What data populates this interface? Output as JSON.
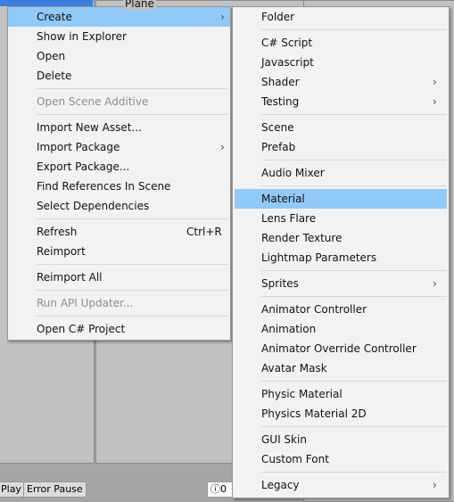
{
  "background": {
    "top_label": "Plane",
    "status_buttons": [
      "Play",
      "Error Pause"
    ],
    "count": "0"
  },
  "context_menu": [
    {
      "label": "Create",
      "submenu": true,
      "highlighted": true
    },
    {
      "label": "Show in Explorer"
    },
    {
      "label": "Open"
    },
    {
      "label": "Delete"
    },
    {
      "sep": true
    },
    {
      "label": "Open Scene Additive",
      "disabled": true
    },
    {
      "sep": true
    },
    {
      "label": "Import New Asset..."
    },
    {
      "label": "Import Package",
      "submenu": true
    },
    {
      "label": "Export Package..."
    },
    {
      "label": "Find References In Scene"
    },
    {
      "label": "Select Dependencies"
    },
    {
      "sep": true
    },
    {
      "label": "Refresh",
      "shortcut": "Ctrl+R"
    },
    {
      "label": "Reimport"
    },
    {
      "sep": true
    },
    {
      "label": "Reimport All"
    },
    {
      "sep": true
    },
    {
      "label": "Run API Updater...",
      "disabled": true
    },
    {
      "sep": true
    },
    {
      "label": "Open C# Project"
    }
  ],
  "create_submenu": [
    {
      "label": "Folder"
    },
    {
      "sep": true
    },
    {
      "label": "C# Script"
    },
    {
      "label": "Javascript"
    },
    {
      "label": "Shader",
      "submenu": true
    },
    {
      "label": "Testing",
      "submenu": true
    },
    {
      "sep": true
    },
    {
      "label": "Scene"
    },
    {
      "label": "Prefab"
    },
    {
      "sep": true
    },
    {
      "label": "Audio Mixer"
    },
    {
      "sep": true
    },
    {
      "label": "Material",
      "highlighted": true
    },
    {
      "label": "Lens Flare"
    },
    {
      "label": "Render Texture"
    },
    {
      "label": "Lightmap Parameters"
    },
    {
      "sep": true
    },
    {
      "label": "Sprites",
      "submenu": true
    },
    {
      "sep": true
    },
    {
      "label": "Animator Controller"
    },
    {
      "label": "Animation"
    },
    {
      "label": "Animator Override Controller"
    },
    {
      "label": "Avatar Mask"
    },
    {
      "sep": true
    },
    {
      "label": "Physic Material"
    },
    {
      "label": "Physics Material 2D"
    },
    {
      "sep": true
    },
    {
      "label": "GUI Skin"
    },
    {
      "label": "Custom Font"
    },
    {
      "sep": true
    },
    {
      "label": "Legacy",
      "submenu": true
    }
  ],
  "colors": {
    "highlight": "#91c9f7",
    "menu_bg": "#f2f2f2",
    "selection": "#3d7fdc"
  }
}
